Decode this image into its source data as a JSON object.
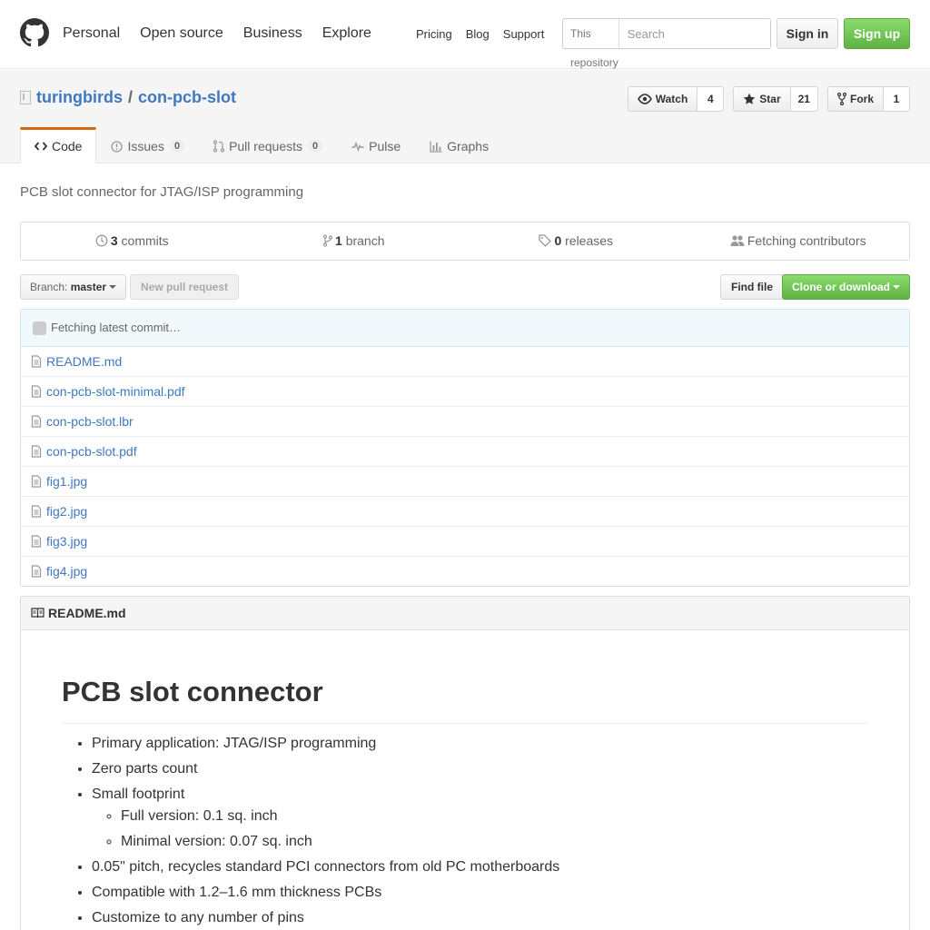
{
  "header": {
    "nav": [
      "Personal",
      "Open source",
      "Business",
      "Explore"
    ],
    "subnav": [
      "Pricing",
      "Blog",
      "Support"
    ],
    "search_scope": "This repository",
    "search_placeholder": "Search",
    "signin": "Sign in",
    "signup": "Sign up"
  },
  "repo": {
    "owner": "turingbirds",
    "separator": "/",
    "name": "con-pcb-slot",
    "watch_label": "Watch",
    "watch_count": "4",
    "star_label": "Star",
    "star_count": "21",
    "fork_label": "Fork",
    "fork_count": "1",
    "description": "PCB slot connector for JTAG/ISP programming"
  },
  "tabs": {
    "code": "Code",
    "issues": "Issues",
    "issues_count": "0",
    "pulls": "Pull requests",
    "pulls_count": "0",
    "pulse": "Pulse",
    "graphs": "Graphs"
  },
  "summary": {
    "commits_num": "3",
    "commits_label": "commits",
    "branch_num": "1",
    "branch_label": "branch",
    "releases_num": "0",
    "releases_label": "releases",
    "contributors": "Fetching contributors"
  },
  "filenav": {
    "branch_prefix": "Branch:",
    "branch_name": "master",
    "new_pr": "New pull request",
    "find_file": "Find file",
    "clone": "Clone or download"
  },
  "commit_tease": "Fetching latest commit…",
  "files": [
    "README.md",
    "con-pcb-slot-minimal.pdf",
    "con-pcb-slot.lbr",
    "con-pcb-slot.pdf",
    "fig1.jpg",
    "fig2.jpg",
    "fig3.jpg",
    "fig4.jpg"
  ],
  "readme": {
    "filename": "README.md",
    "title": "PCB slot connector",
    "items": [
      "Primary application: JTAG/ISP programming",
      "Zero parts count",
      "Small footprint",
      "0.05\" pitch, recycles standard PCI connectors from old PC motherboards",
      "Compatible with 1.2–1.6 mm thickness PCBs",
      "Customize to any number of pins"
    ],
    "subitems": [
      "Full version: 0.1 sq. inch",
      "Minimal version: 0.07 sq. inch"
    ]
  },
  "colors": {
    "link": "#4078c0",
    "accent_tab": "#d26911",
    "signup_green": "#60b044"
  }
}
